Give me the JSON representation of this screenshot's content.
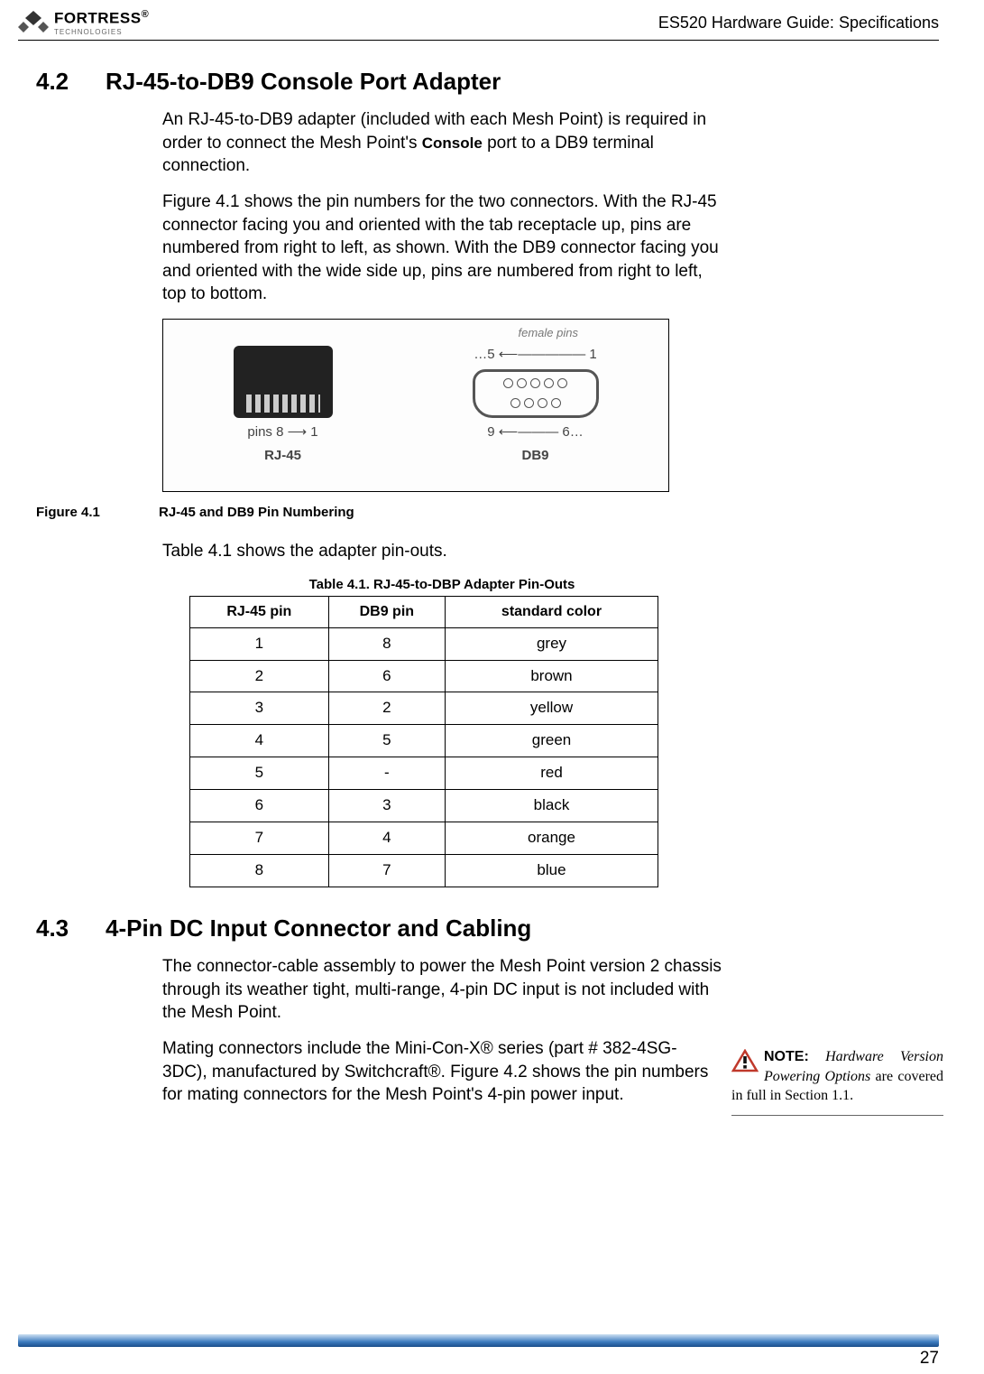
{
  "header": {
    "brand_main": "FORTRESS",
    "brand_sub": "TECHNOLOGIES",
    "reg": "®",
    "doc_title": "ES520 Hardware Guide: Specifications"
  },
  "section42": {
    "num": "4.2",
    "title": "RJ-45-to-DB9 Console Port Adapter",
    "para1a": "An RJ-45-to-DB9 adapter (included with each Mesh Point) is required in order to connect the Mesh Point's ",
    "para1_term": "Console",
    "para1b": " port to a DB9 terminal connection.",
    "para2": "Figure 4.1 shows the pin numbers for the two connectors. With the RJ-45 connector facing you and oriented with the tab receptacle up, pins are numbered from right to left, as shown. With the DB9 connector facing you and oriented with the wide side up, pins are numbered from right to left, top to bottom.",
    "fig_labels": {
      "rj45": "RJ-45",
      "db9": "DB9",
      "pins8": "pins 8",
      "one": "1",
      "five": "…5",
      "fem": "female pins",
      "nine": "9",
      "six": "6…"
    },
    "fig_caption_label": "Figure 4.1",
    "fig_caption_text": "RJ-45 and DB9 Pin Numbering",
    "table_intro": "Table 4.1 shows the adapter pin-outs.",
    "table_caption": "Table 4.1. RJ-45-to-DBP Adapter Pin-Outs",
    "table_headers": [
      "RJ-45 pin",
      "DB9 pin",
      "standard color"
    ],
    "table_rows": [
      [
        "1",
        "8",
        "grey"
      ],
      [
        "2",
        "6",
        "brown"
      ],
      [
        "3",
        "2",
        "yellow"
      ],
      [
        "4",
        "5",
        "green"
      ],
      [
        "5",
        "-",
        "red"
      ],
      [
        "6",
        "3",
        "black"
      ],
      [
        "7",
        "4",
        "orange"
      ],
      [
        "8",
        "7",
        "blue"
      ]
    ]
  },
  "section43": {
    "num": "4.3",
    "title": "4-Pin DC Input Connector and Cabling",
    "para1": "The connector-cable assembly to power the Mesh Point version 2 chassis through its weather tight, multi-range, 4-pin DC input is not included with the Mesh Point.",
    "para2": "Mating connectors include the Mini-Con-X® series (part # 382-4SG-3DC), manufactured by Switchcraft®. Figure 4.2 shows the pin numbers for mating connectors for the Mesh Point's 4-pin power input."
  },
  "sidenote": {
    "label": "NOTE:",
    "text_italic1": "Hardware Version Powering Options",
    "text_rest": " are covered in full in Section 1.1."
  },
  "page_number": "27"
}
